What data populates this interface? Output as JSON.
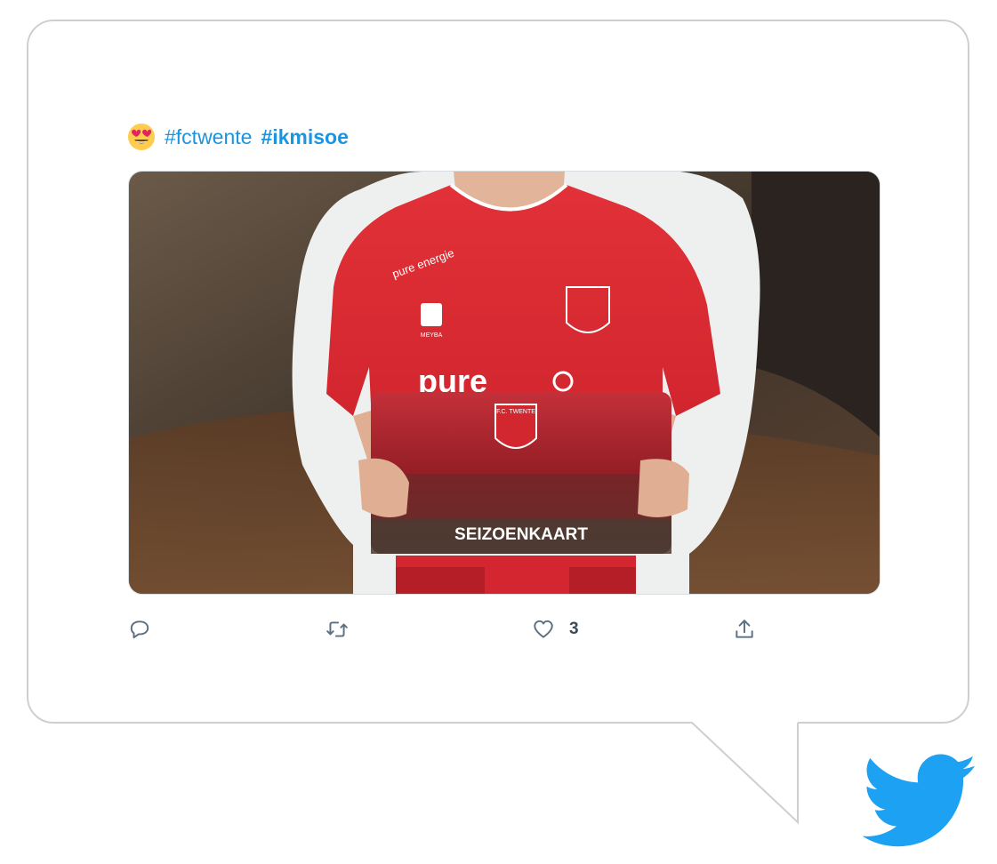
{
  "tweet": {
    "emoji": "smiling-face-with-heart-eyes",
    "hashtags": [
      "#fctwente",
      "#ikmisoe"
    ]
  },
  "media": {
    "shirt_sponsor_small": "pure energie",
    "shirt_sponsor_large": "pure",
    "card_text": "SEIZOENKAART",
    "badge_text": "F.C. TWENTE",
    "kit_brand": "MEYBA"
  },
  "actions": {
    "reply_icon": "reply-icon",
    "retweet_icon": "retweet-icon",
    "like_icon": "heart-icon",
    "like_count": "3",
    "share_icon": "share-icon"
  },
  "colors": {
    "hashtag": "#1b95e0",
    "twitter_blue": "#1da1f2",
    "action_gray": "#5b7083",
    "border": "#cdd0d3",
    "shirt_red": "#d9252e"
  }
}
